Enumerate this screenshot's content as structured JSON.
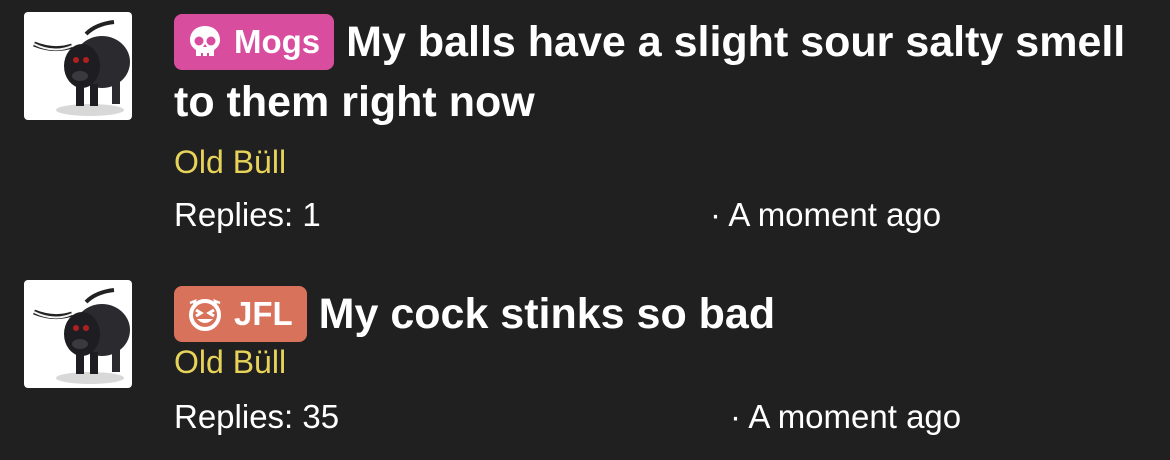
{
  "threads": [
    {
      "tag": {
        "label": "Mogs",
        "icon": "skull-icon",
        "color": "#d94d9e"
      },
      "title": "My balls have a slight sour salty smell to them right now",
      "author": "Old Büll",
      "replies": "Replies: 1",
      "time": "· A moment ago"
    },
    {
      "tag": {
        "label": "JFL",
        "icon": "laughing-face-icon",
        "color": "#d9725a"
      },
      "title": "My cock stinks so bad",
      "author": "Old Büll",
      "replies": "Replies: 35",
      "time": "· A moment ago"
    }
  ],
  "colors": {
    "background": "#202020",
    "author": "#e7d35a",
    "text": "#ffffff"
  }
}
